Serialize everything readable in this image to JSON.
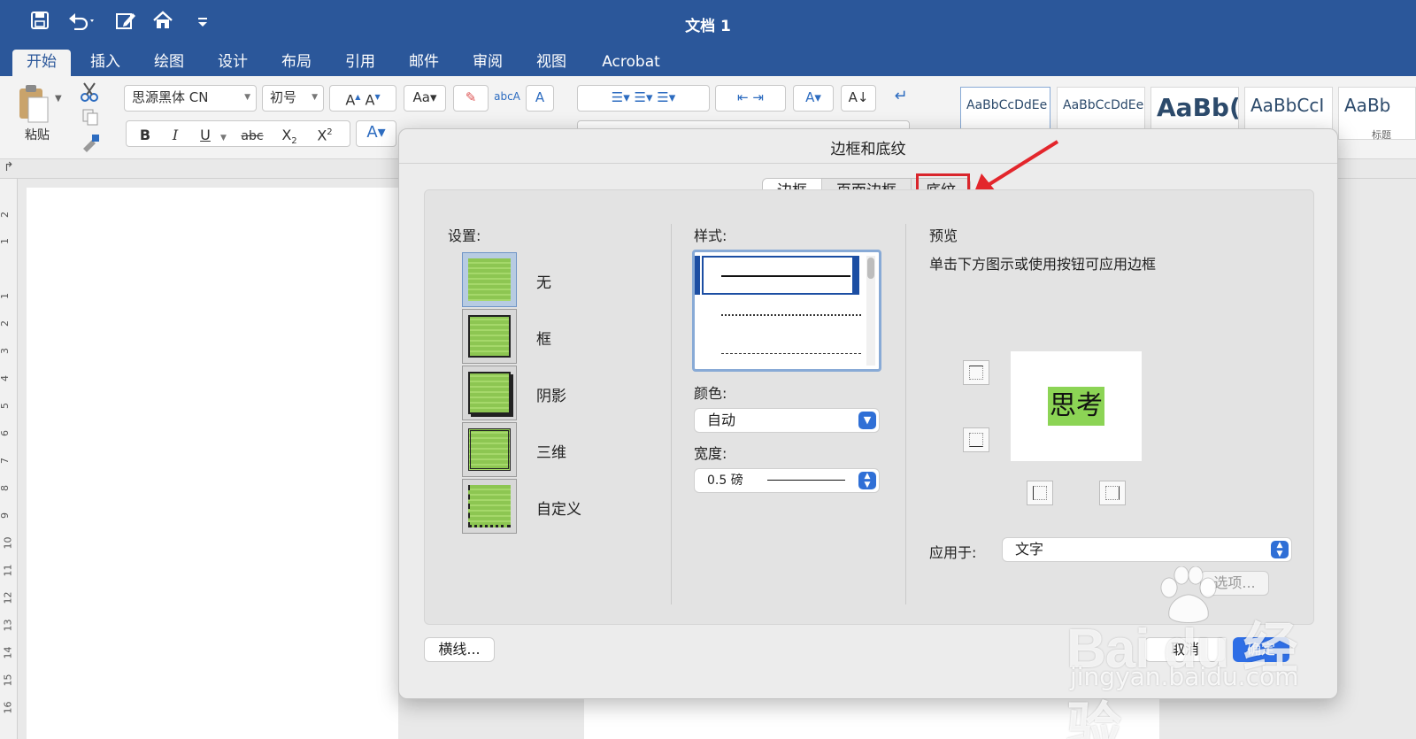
{
  "app": {
    "title": "文档 1"
  },
  "ribbon_tabs": [
    "开始",
    "插入",
    "绘图",
    "设计",
    "布局",
    "引用",
    "邮件",
    "审阅",
    "视图",
    "Acrobat"
  ],
  "ribbon": {
    "paste_label": "粘贴",
    "font_name": "思源黑体 CN",
    "font_size": "初号",
    "bold": "B",
    "italic": "I",
    "underline": "U",
    "strike": "abc",
    "styles": [
      "AaBbCcDdEe",
      "AaBbCcDdEe",
      "AaBb(",
      "AaBbCcI",
      "AaBb"
    ],
    "style_caption": "标题"
  },
  "ruler_numbers": [
    "2",
    "1",
    "1",
    "2",
    "3",
    "4",
    "5",
    "6",
    "7",
    "8",
    "9",
    "10",
    "11",
    "12",
    "13",
    "14",
    "15",
    "16"
  ],
  "dialog": {
    "title": "边框和底纹",
    "tabs": [
      "边框",
      "页面边框",
      "底纹"
    ],
    "settings_label": "设置:",
    "settings": [
      "无",
      "框",
      "阴影",
      "三维",
      "自定义"
    ],
    "style_label": "样式:",
    "color_label": "颜色:",
    "color_value": "自动",
    "width_label": "宽度:",
    "width_value": "0.5 磅",
    "preview_label": "预览",
    "preview_hint": "单击下方图示或使用按钮可应用边框",
    "preview_text": "思考",
    "apply_label": "应用于:",
    "apply_value": "文字",
    "options_button": "选项...",
    "horizontal_line_button": "横线...",
    "cancel_button": "取消",
    "ok_button": "确定"
  },
  "watermark": {
    "main": "Bai du 经验",
    "sub": "jingyan.baidu.com"
  },
  "colors": {
    "title_bar": "#2b579a",
    "accent": "#2e6ee6",
    "shading": "#8cd455",
    "annotation": "#d9262c"
  }
}
